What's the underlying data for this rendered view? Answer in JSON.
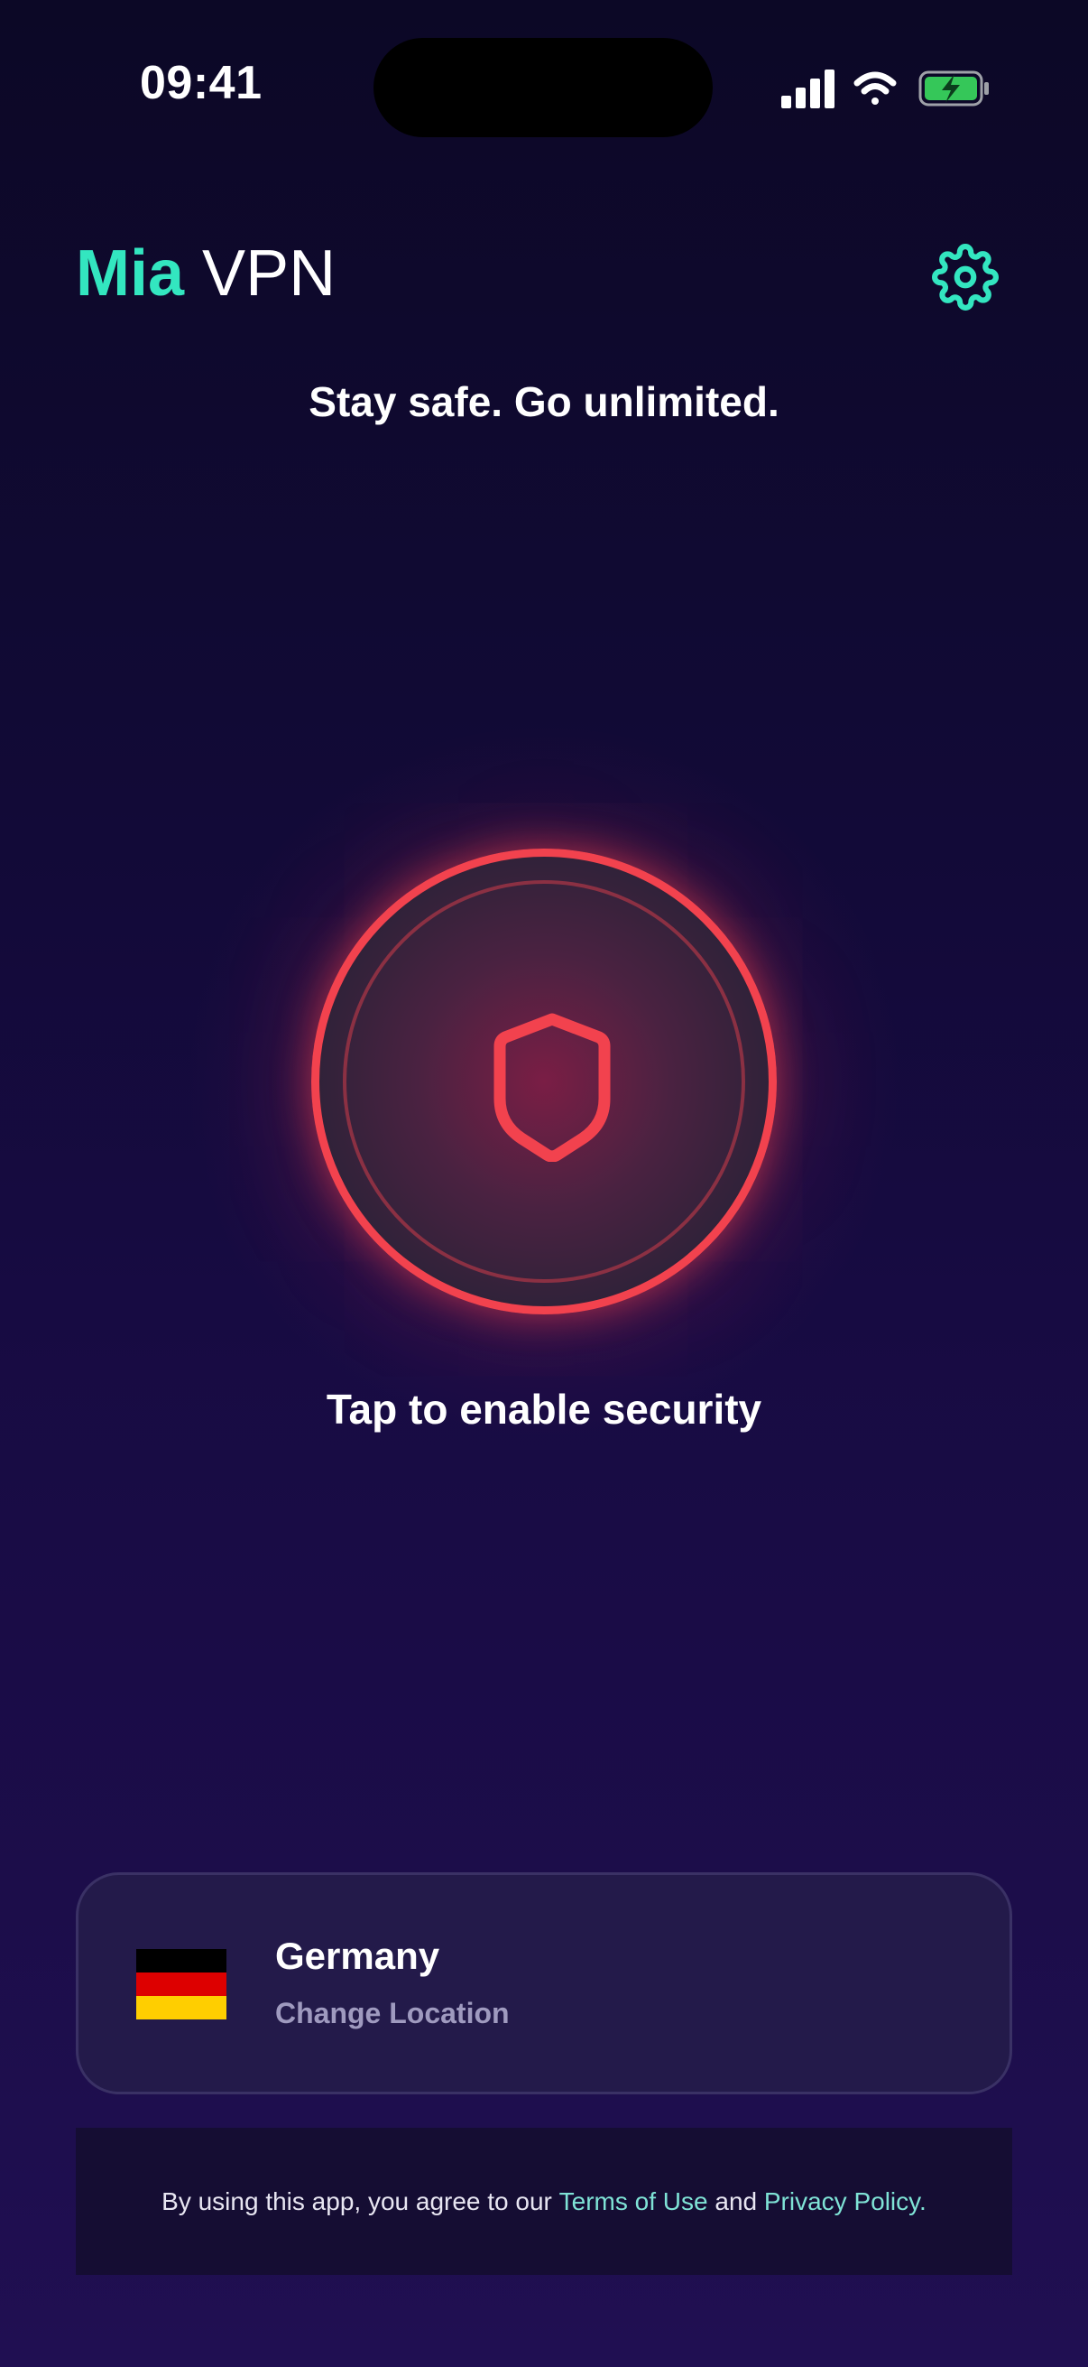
{
  "status_bar": {
    "time": "09:41",
    "icons": [
      "cellular-signal-icon",
      "wifi-icon",
      "battery-charging-icon"
    ]
  },
  "header": {
    "brand_primary": "Mia",
    "brand_secondary": "VPN",
    "settings_icon": "gear-icon"
  },
  "tagline": "Stay safe. Go unlimited.",
  "connect": {
    "icon": "shield-icon",
    "label": "Tap to enable security",
    "state": "disconnected"
  },
  "location": {
    "flag_icon": "germany-flag-icon",
    "country": "Germany",
    "action": "Change Location"
  },
  "footer": {
    "text_before": "By using this app, you agree to our",
    "terms_link": "Terms of Use",
    "text_middle": "and",
    "privacy_link": "Privacy Policy.",
    "text_after": ""
  },
  "colors": {
    "accent": "#33e6c0",
    "danger": "#f2424e",
    "link": "#7fe3d6",
    "background_top": "#0c0826",
    "background_bottom": "#200f52",
    "card": "#231a4a"
  }
}
